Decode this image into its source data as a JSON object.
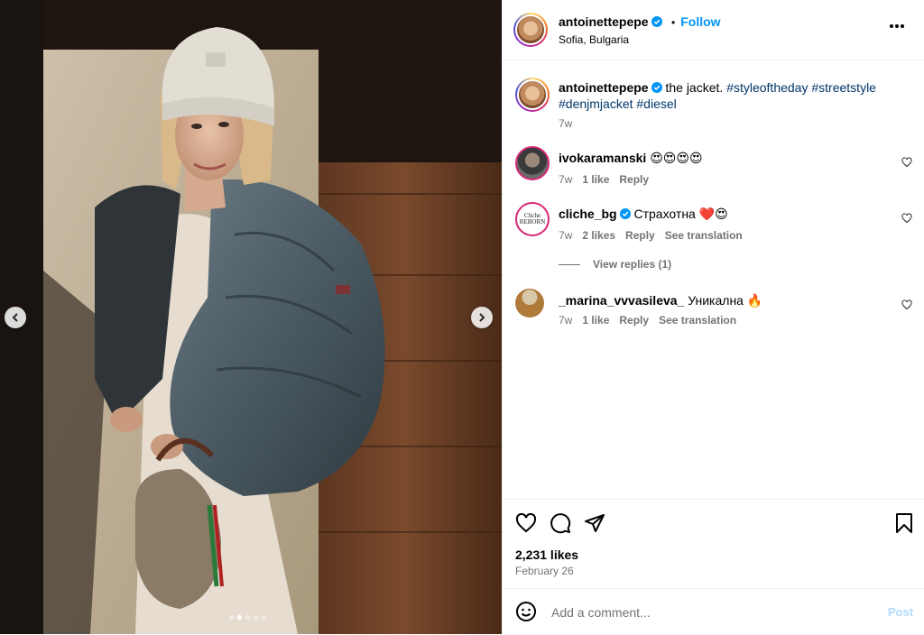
{
  "post": {
    "author": "antoinettepepe",
    "location": "Sofia, Bulgaria",
    "follow_label": "Follow",
    "separator": "•",
    "caption": {
      "text": "the jacket.",
      "hashtags_line1": [
        "#styleoftheday",
        "#streetstyle"
      ],
      "hashtags_line2": [
        "#denjmjacket",
        "#diesel"
      ],
      "time": "7w"
    },
    "likes": "2,231 likes",
    "date": "February 26",
    "carousel": {
      "total": 5,
      "active": 2
    }
  },
  "comments": [
    {
      "user": "ivokaramanski",
      "verified": false,
      "text": "😍😍😍😍",
      "time": "7w",
      "likes": "1 like",
      "reply": "Reply",
      "translate": ""
    },
    {
      "user": "cliche_bg",
      "verified": true,
      "text": "Страхотна ❤️😍",
      "time": "7w",
      "likes": "2 likes",
      "reply": "Reply",
      "translate": "See translation",
      "avatar_text": "Cliche REBORN"
    },
    {
      "user": "_marina_vvvasileva_",
      "verified": false,
      "text": "Уникална 🔥",
      "time": "7w",
      "likes": "1 like",
      "reply": "Reply",
      "translate": "See translation"
    }
  ],
  "view_replies": "View replies (1)",
  "add_comment": {
    "placeholder": "Add a comment...",
    "post_label": "Post"
  },
  "icons": {
    "more": "more-options-icon",
    "heart": "heart-icon",
    "comment": "comment-icon",
    "share": "share-icon",
    "save": "bookmark-icon",
    "emoji": "emoji-icon",
    "verified": "verified-badge-icon",
    "prev": "chevron-left-icon",
    "next": "chevron-right-icon"
  },
  "colors": {
    "accent": "#0095f6",
    "hashtag": "#00376b",
    "muted": "#737373",
    "verified": "#0095f6"
  }
}
